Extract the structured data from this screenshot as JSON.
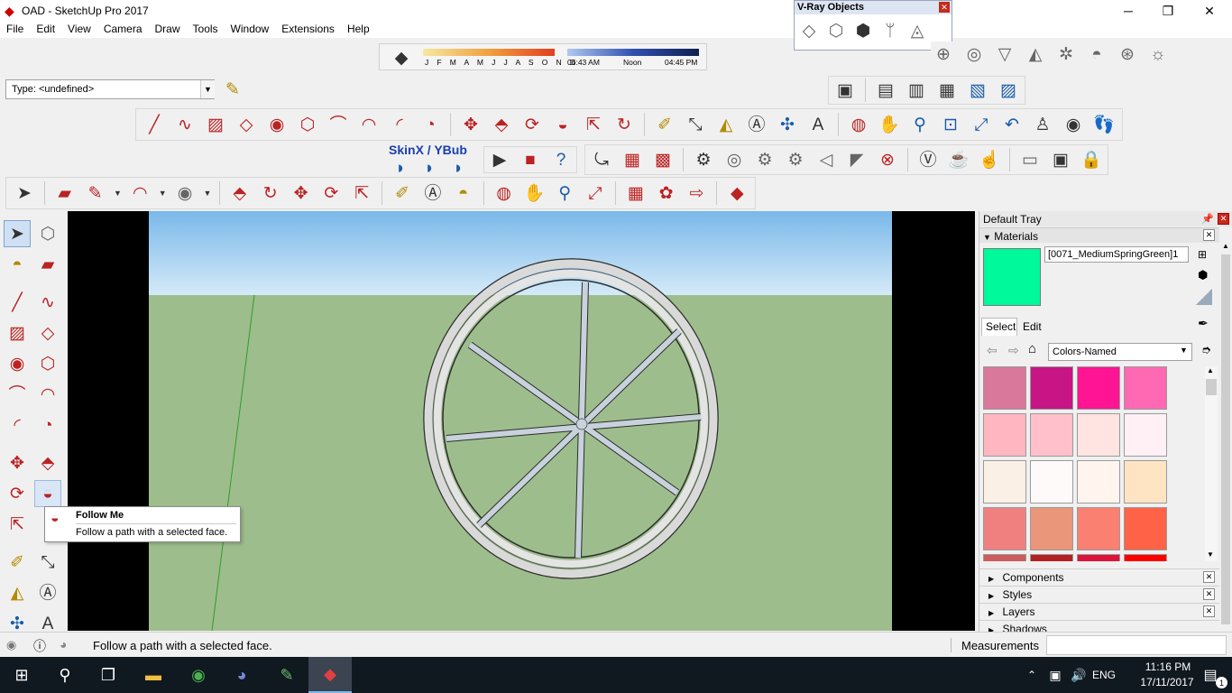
{
  "window": {
    "title": "OAD - SketchUp Pro 2017",
    "minimize": "─",
    "maximize": "❐",
    "close": "✕"
  },
  "menu": [
    "File",
    "Edit",
    "View",
    "Camera",
    "Draw",
    "Tools",
    "Window",
    "Extensions",
    "Help"
  ],
  "type_field": {
    "value": "Type: <undefined>"
  },
  "vray_toolbar": {
    "title": "V-Ray Objects"
  },
  "shadows_toolbar": {
    "months": "J F M A M J J A S O N D",
    "time_start": "06:43 AM",
    "time_mid": "Noon",
    "time_end": "04:45 PM"
  },
  "skinx_label": "SkinX / YBub",
  "tooltip": {
    "title": "Follow Me",
    "description": "Follow a path with a selected face."
  },
  "tray": {
    "title": "Default Tray",
    "materials_header": "Materials",
    "material_name": "[0071_MediumSpringGreen]1",
    "material_color": "#00f99b",
    "tab_select": "Select",
    "tab_edit": "Edit",
    "library": "Colors-Named",
    "swatches": [
      "#d9789a",
      "#c71585",
      "#ff1493",
      "#ff69b4",
      "#ffb6c1",
      "#ffc0cb",
      "#ffe4e1",
      "#fff0f5",
      "#faf0e6",
      "#fffafa",
      "#fff5ee",
      "#ffe4c4",
      "#f08080",
      "#e9967a",
      "#fa8072",
      "#ff6347",
      "#cd5c5c",
      "#b22222",
      "#dc143c",
      "#ff0000"
    ],
    "sections": [
      "Components",
      "Styles",
      "Layers",
      "Shadows"
    ]
  },
  "status": {
    "message": "Follow a path with a selected face.",
    "measurements_label": "Measurements"
  },
  "taskbar": {
    "language": "ENG",
    "time": "11:16 PM",
    "date": "17/11/2017",
    "notification_count": "1"
  }
}
